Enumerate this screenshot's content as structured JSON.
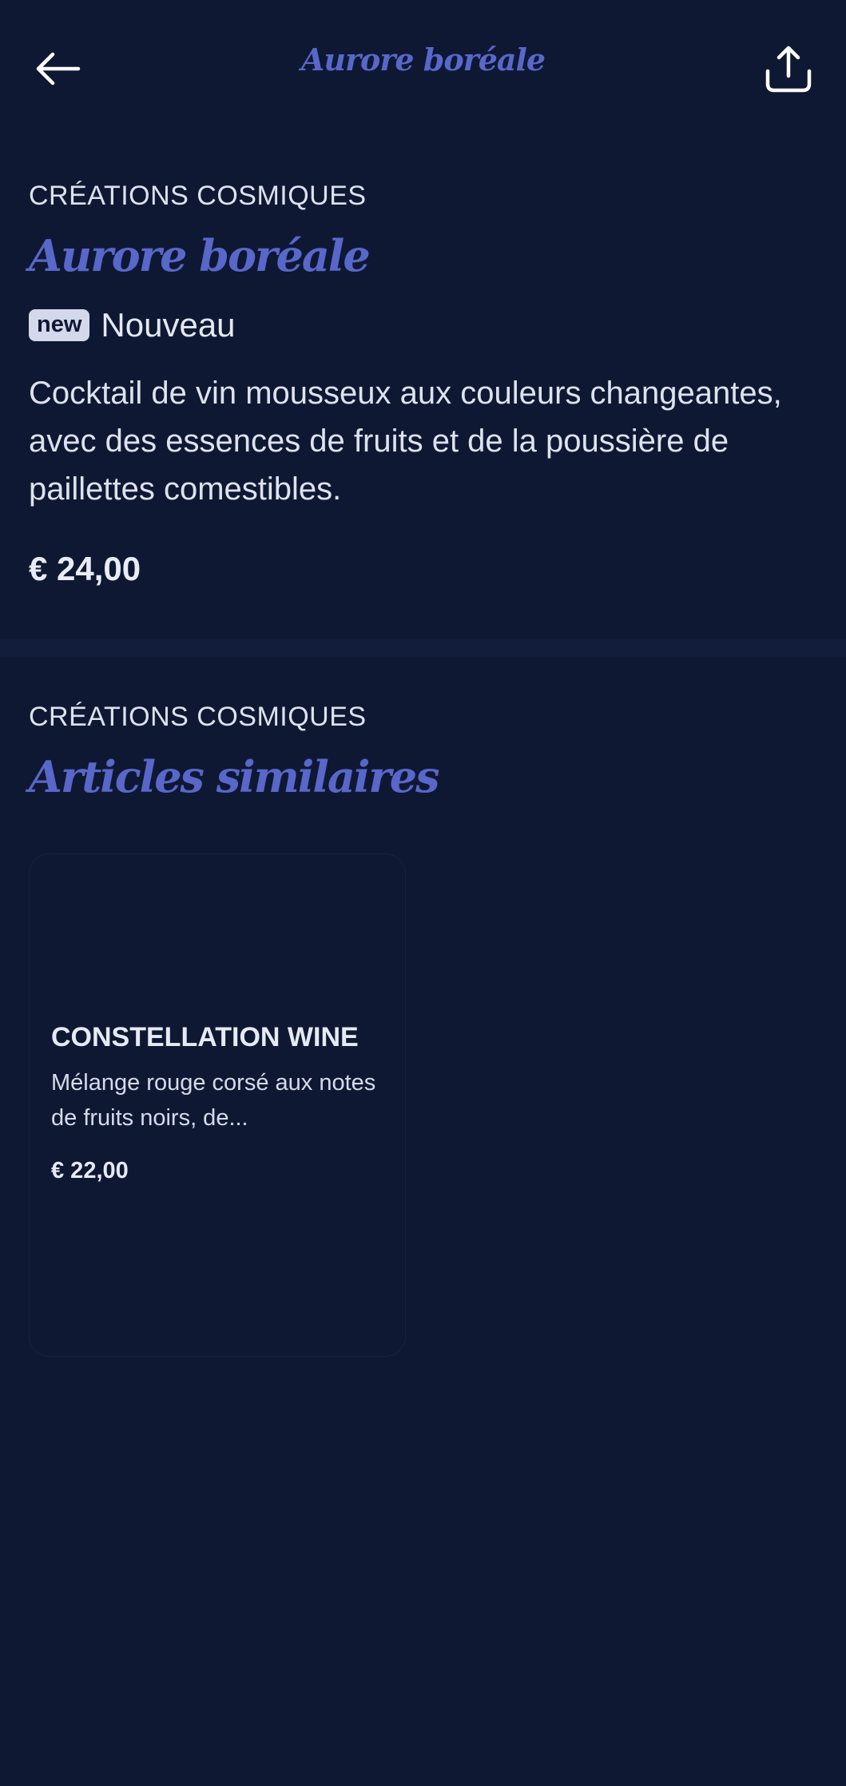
{
  "header": {
    "title": "Aurore boréale",
    "back_icon": "arrow-left-icon",
    "share_icon": "share-icon"
  },
  "product": {
    "category": "CRÉATIONS COSMIQUES",
    "name": "Aurore boréale",
    "badge": "new",
    "badge_label": "Nouveau",
    "description": "Cocktail de vin mousseux aux couleurs changeantes, avec des essences de fruits et de la poussière de paillettes comestibles.",
    "price": "€ 24,00"
  },
  "similar": {
    "category": "CRÉATIONS COSMIQUES",
    "title": "Articles similaires",
    "items": [
      {
        "name": "CONSTELLATION WINE",
        "description": "Mélange rouge corsé aux notes de fruits noirs, de...",
        "price": "€ 22,00"
      }
    ]
  },
  "colors": {
    "background": "#0f1833",
    "accent": "#5867c9",
    "text": "#e4e8f4",
    "badge_bg": "#d3d8ea"
  }
}
